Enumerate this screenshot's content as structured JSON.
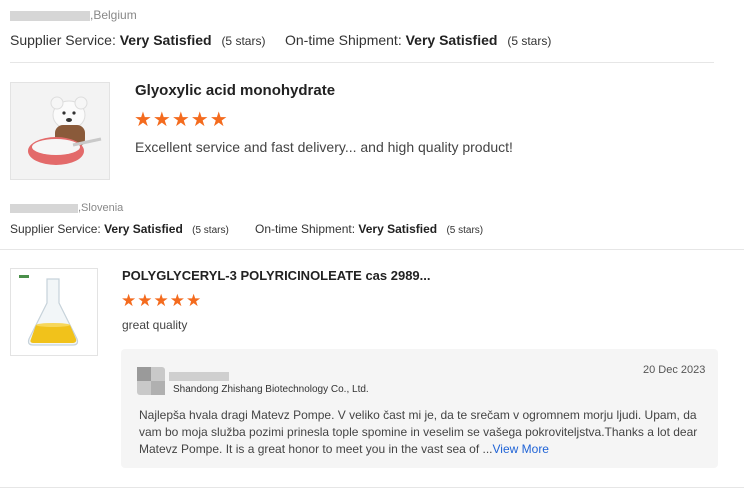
{
  "review1": {
    "location_suffix": ",Belgium",
    "supplier_label": "Supplier Service:",
    "supplier_value": "Very Satisfied",
    "supplier_stars": "(5 stars)",
    "shipment_label": "On-time Shipment:",
    "shipment_value": "Very Satisfied",
    "shipment_stars": "(5 stars)"
  },
  "review2": {
    "product_title": "Glyoxylic acid monohydrate",
    "stars": "★★★★★",
    "rating": 5,
    "comment": "Excellent service and fast delivery... and high quality product!",
    "location_suffix": ",Slovenia",
    "supplier_label": "Supplier Service:",
    "supplier_value": "Very Satisfied",
    "supplier_stars": "(5 stars)",
    "shipment_label": "On-time Shipment:",
    "shipment_value": "Very Satisfied",
    "shipment_stars": "(5 stars)"
  },
  "review3": {
    "product_title": "POLYGLYCERYL-3 POLYRICINOLEATE cas 2989...",
    "stars": "★★★★★",
    "rating": 5,
    "comment": "great quality",
    "reply": {
      "company": "Shandong Zhishang Biotechnology Co., Ltd.",
      "date": "20 Dec 2023",
      "text": "Najlepša hvala dragi Matevz Pompe. V veliko čast mi je, da te srečam v ogromnem morju ljudi. Upam, da vam bo moja služba pozimi prinesla tople spomine in veselim se vašega pokroviteljstva.Thanks a lot dear Matevz Pompe. It is a great honor to meet you in the vast sea of ...",
      "view_more": "View More"
    }
  },
  "colors": {
    "star": "#f46b1e",
    "link": "#1f63d6",
    "reply_bg": "#f5f5f5"
  }
}
